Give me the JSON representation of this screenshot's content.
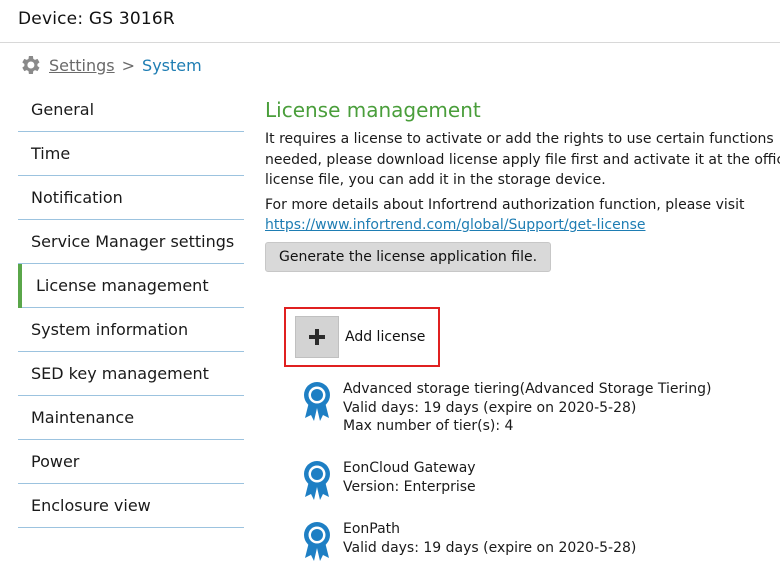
{
  "header": {
    "title": "Device: GS 3016R"
  },
  "breadcrumb": {
    "parent": "Settings",
    "separator": ">",
    "current": "System"
  },
  "sidebar": {
    "items": [
      {
        "label": "General"
      },
      {
        "label": "Time"
      },
      {
        "label": "Notification"
      },
      {
        "label": "Service Manager settings"
      },
      {
        "label": "License management",
        "active": true
      },
      {
        "label": "System information"
      },
      {
        "label": "SED key management"
      },
      {
        "label": "Maintenance"
      },
      {
        "label": "Power"
      },
      {
        "label": "Enclosure view"
      }
    ]
  },
  "main": {
    "heading": "License management",
    "description": [
      "It requires a license to activate or add the rights to use certain functions",
      "needed, please download license apply file first and activate it at the offici",
      "license file, you can add it in the storage device."
    ],
    "details_text": "For more details about Infortrend authorization function, please visit",
    "link": "https://www.infortrend.com/global/Support/get-license",
    "generate_button": "Generate the license application file.",
    "add_license_button": "Add license",
    "licenses": [
      {
        "lines": [
          "Advanced storage tiering(Advanced Storage Tiering)",
          "Valid days: 19 days (expire on 2020-5-28)",
          "Max number of tier(s): 4"
        ]
      },
      {
        "lines": [
          "EonCloud Gateway",
          "Version: Enterprise"
        ]
      },
      {
        "lines": [
          "EonPath",
          "Valid days: 19 days (expire on 2020-5-28)"
        ]
      }
    ]
  },
  "colors": {
    "accent_green": "#4a9e3b",
    "link_blue": "#1e7db3",
    "badge_blue": "#1e7fc4",
    "highlight_red": "#e02020"
  },
  "icons": {
    "breadcrumb": "gear-icon",
    "add": "plus-icon",
    "license": "award-ribbon-icon"
  }
}
